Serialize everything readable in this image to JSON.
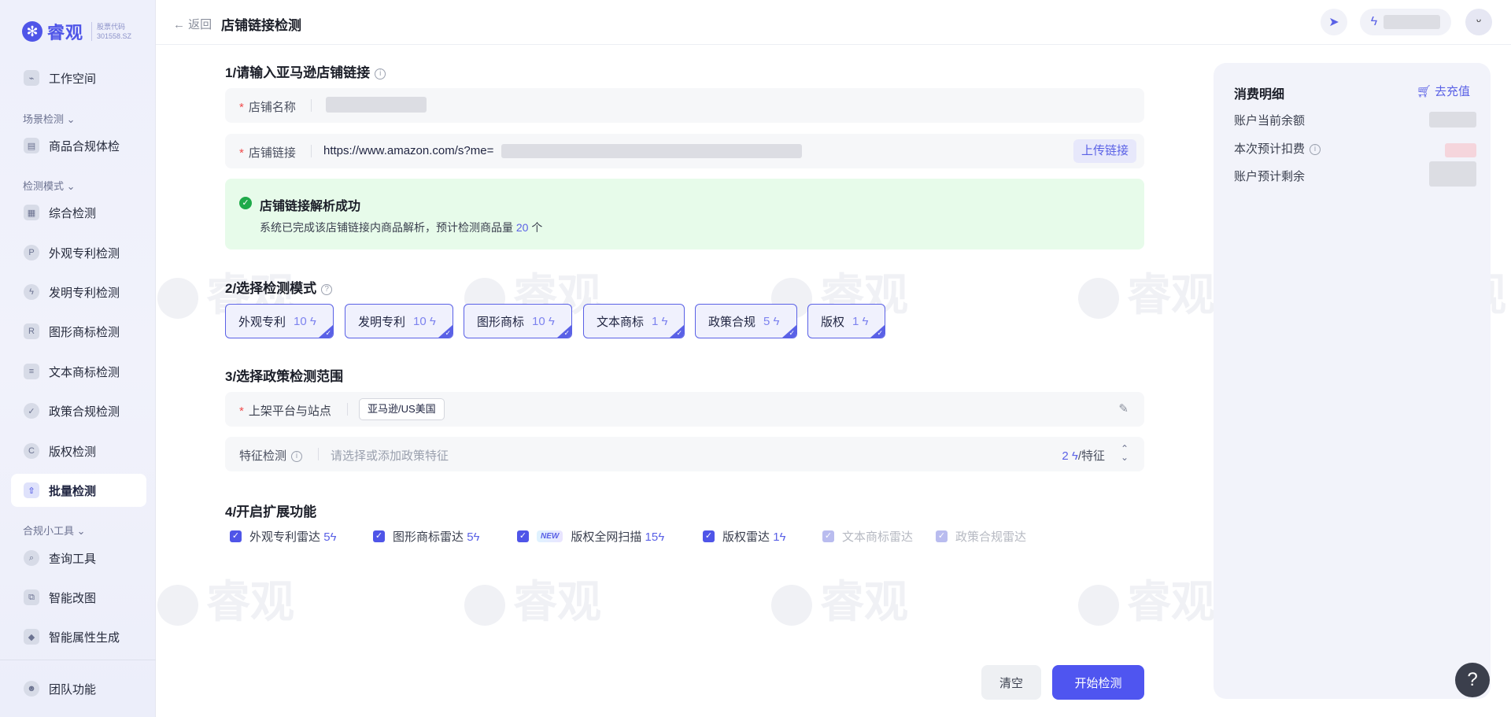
{
  "brand": {
    "name": "睿观",
    "sub_line1": "股票代码",
    "sub_line2": "301558.SZ"
  },
  "watermark": "睿观",
  "sidebar": {
    "workspace": "工作空间",
    "group_scene": "场景检测",
    "product_check": "商品合规体检",
    "group_mode": "检测模式",
    "items": [
      {
        "label": "综合检测",
        "icon": "grid-icon"
      },
      {
        "label": "外观专利检测",
        "icon": "P"
      },
      {
        "label": "发明专利检测",
        "icon": "bolt-icon"
      },
      {
        "label": "图形商标检测",
        "icon": "R"
      },
      {
        "label": "文本商标检测",
        "icon": "text-icon"
      },
      {
        "label": "政策合规检测",
        "icon": "shield-icon"
      },
      {
        "label": "版权检测",
        "icon": "C"
      },
      {
        "label": "批量检测",
        "icon": "upload-icon"
      }
    ],
    "group_tools": "合规小工具",
    "tools": [
      {
        "label": "查询工具"
      },
      {
        "label": "智能改图"
      },
      {
        "label": "智能属性生成"
      }
    ],
    "team": "团队功能"
  },
  "header": {
    "back": "返回",
    "title": "店铺链接检测"
  },
  "section1": {
    "title": "1/请输入亚马逊店铺链接",
    "shop_name_label": "店铺名称",
    "shop_link_label": "店铺链接",
    "shop_link_value": "https://www.amazon.com/s?me=",
    "upload_button": "上传链接",
    "success_title": "店铺链接解析成功",
    "success_text_prefix": "系统已完成该店铺链接内商品解析，预计检测商品量",
    "success_count": "20",
    "success_suffix": "个"
  },
  "section2": {
    "title": "2/选择检测模式",
    "modes": [
      {
        "label": "外观专利",
        "cost": "10"
      },
      {
        "label": "发明专利",
        "cost": "10"
      },
      {
        "label": "图形商标",
        "cost": "10"
      },
      {
        "label": "文本商标",
        "cost": "1"
      },
      {
        "label": "政策合规",
        "cost": "5"
      },
      {
        "label": "版权",
        "cost": "1"
      }
    ]
  },
  "section3": {
    "title": "3/选择政策检测范围",
    "platform_label": "上架平台与站点",
    "platform_tag": "亚马逊/US美国",
    "feature_label": "特征检测",
    "feature_placeholder": "请选择或添加政策特征",
    "feature_cost": "2",
    "feature_unit": "/特征"
  },
  "section4": {
    "title": "4/开启扩展功能",
    "options": [
      {
        "label": "外观专利雷达",
        "cost": "5",
        "checked": true,
        "disabled": false
      },
      {
        "label": "图形商标雷达",
        "cost": "5",
        "checked": true,
        "disabled": false
      },
      {
        "label": "版权全网扫描",
        "cost": "15",
        "checked": true,
        "disabled": false,
        "badge": "NEW"
      },
      {
        "label": "版权雷达",
        "cost": "1",
        "checked": true,
        "disabled": false
      },
      {
        "label": "文本商标雷达",
        "checked": true,
        "disabled": true
      },
      {
        "label": "政策合规雷达",
        "checked": true,
        "disabled": true
      }
    ]
  },
  "actions": {
    "clear": "清空",
    "start": "开始检测"
  },
  "panel": {
    "title": "消费明细",
    "recharge": "去充值",
    "balance": "账户当前余额",
    "deduct": "本次预计扣费",
    "remain": "账户预计剩余"
  },
  "help": "?"
}
